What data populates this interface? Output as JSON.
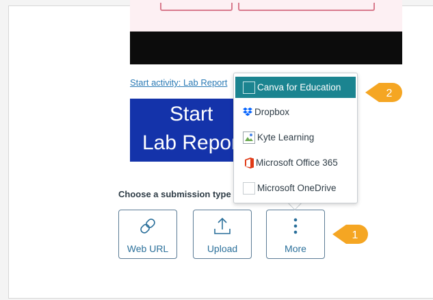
{
  "start_activity_link": "Start activity: Lab Report",
  "start_button": {
    "line1": "Start",
    "line2": "Lab Report"
  },
  "submission": {
    "label": "Choose a submission type",
    "buttons": [
      {
        "label": "Web URL",
        "icon": "link-icon"
      },
      {
        "label": "Upload",
        "icon": "upload-icon"
      },
      {
        "label": "More",
        "icon": "more-vertical-icon"
      }
    ]
  },
  "more_menu": {
    "items": [
      {
        "label": "Canva for Education",
        "icon": "canva-icon",
        "active": true
      },
      {
        "label": "Dropbox",
        "icon": "dropbox-icon"
      },
      {
        "label": "Kyte Learning",
        "icon": "broken-image-icon"
      },
      {
        "label": "Microsoft Office 365",
        "icon": "office-365-icon"
      },
      {
        "label": "Microsoft OneDrive",
        "icon": "onedrive-icon"
      }
    ]
  },
  "callouts": [
    "1",
    "2"
  ],
  "colors": {
    "accent": "#1b8490",
    "callout": "#f5a623",
    "start_box": "#1433aa",
    "link": "#2a7ab5"
  }
}
